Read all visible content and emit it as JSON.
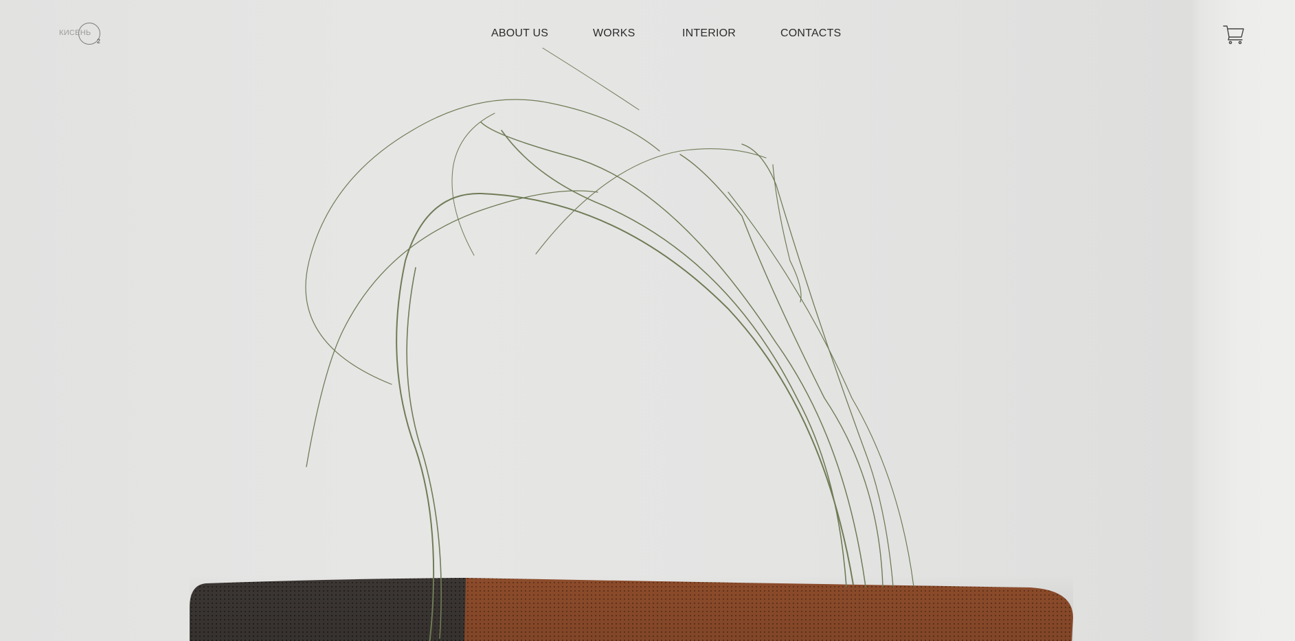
{
  "header": {
    "logo_text": "КИСЕНЬ",
    "logo_sub": "2",
    "nav": [
      {
        "label": "ABOUT US"
      },
      {
        "label": "WORKS"
      },
      {
        "label": "INTERIOR"
      },
      {
        "label": "CONTACTS"
      }
    ],
    "cart_icon": "shopping-cart-icon"
  },
  "hero": {
    "image": "dry-grass-stems-on-knitted-cushion-photo",
    "colors": {
      "wall": "#e3e3e2",
      "cushion_dark": "#3a3532",
      "cushion_brown": "#8a4a2a",
      "grass": "#6e7a52"
    }
  }
}
